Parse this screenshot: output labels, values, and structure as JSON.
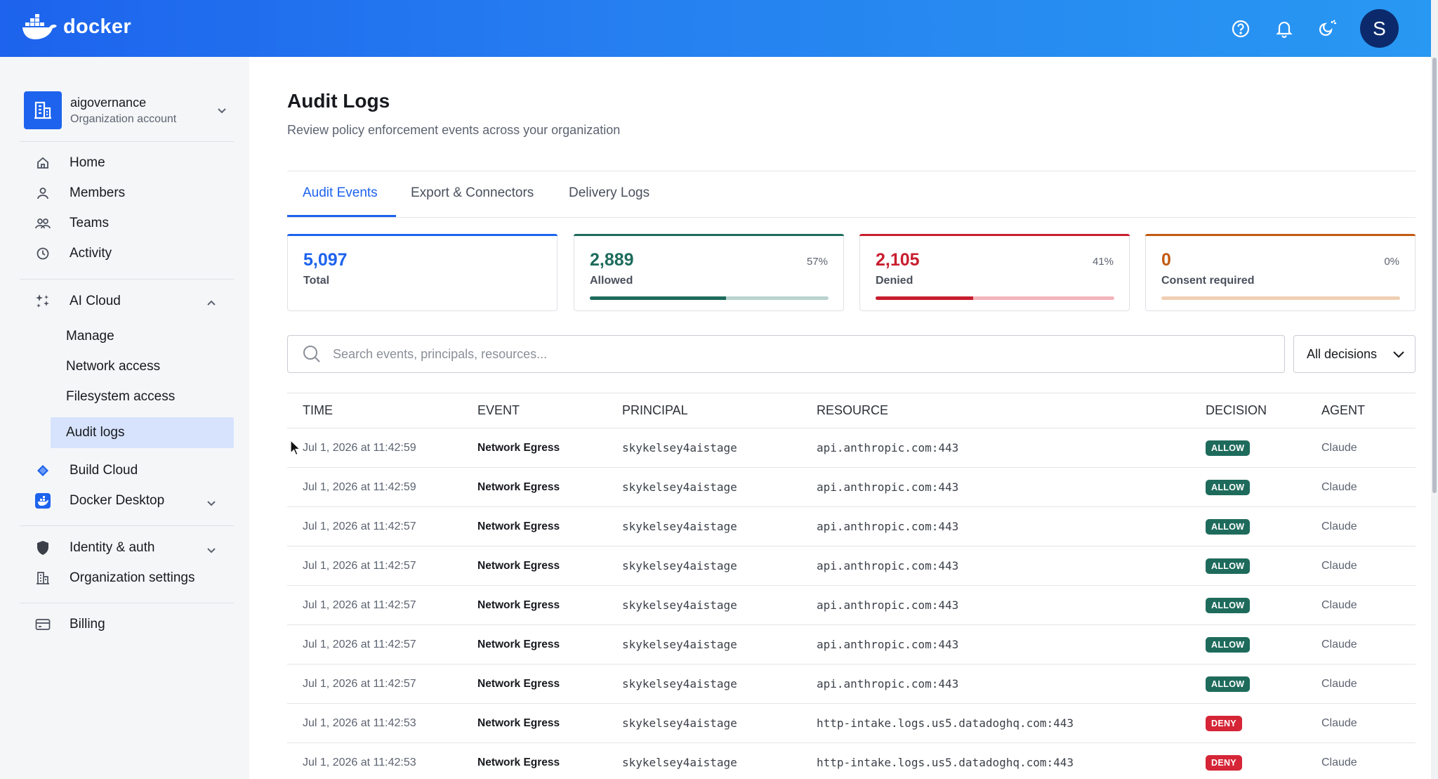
{
  "header": {
    "brand": "docker",
    "avatar_initial": "S",
    "icons": [
      "help-icon",
      "bell-icon",
      "theme-toggle-icon"
    ]
  },
  "sidebar": {
    "org_name": "aigovernance",
    "org_type": "Organization account",
    "items": [
      {
        "label": "Home",
        "icon": "home-icon"
      },
      {
        "label": "Members",
        "icon": "person-icon"
      },
      {
        "label": "Teams",
        "icon": "teams-icon"
      },
      {
        "label": "Activity",
        "icon": "clock-icon"
      }
    ],
    "ai_cloud": {
      "label": "AI Cloud",
      "children": [
        "Manage",
        "Network access",
        "Filesystem access",
        "Audit logs"
      ],
      "active": "Audit logs"
    },
    "build_cloud": "Build Cloud",
    "docker_desktop": "Docker Desktop",
    "identity": "Identity & auth",
    "org_settings": "Organization settings",
    "billing": "Billing"
  },
  "page": {
    "title": "Audit Logs",
    "subtitle": "Review policy enforcement events across your organization",
    "tabs": [
      "Audit Events",
      "Export & Connectors",
      "Delivery Logs"
    ],
    "active_tab": "Audit Events"
  },
  "stats": [
    {
      "value": "5,097",
      "label": "Total",
      "pct": "",
      "fraction": 1.0,
      "color": "#1d63ed"
    },
    {
      "value": "2,889",
      "label": "Allowed",
      "pct": "57%",
      "fraction": 0.57,
      "color": "#1e6b5c",
      "track": "#b9d3cf"
    },
    {
      "value": "2,105",
      "label": "Denied",
      "pct": "41%",
      "fraction": 0.41,
      "color": "#c81e2e",
      "track": "#f4b5bc"
    },
    {
      "value": "0",
      "label": "Consent required",
      "pct": "0%",
      "fraction": 0.0,
      "color": "#c25a10",
      "track": "#efcfb2"
    }
  ],
  "search": {
    "placeholder": "Search events, principals, resources..."
  },
  "filter": {
    "selected": "All decisions"
  },
  "table": {
    "columns": [
      "TIME",
      "EVENT",
      "PRINCIPAL",
      "RESOURCE",
      "DECISION",
      "AGENT"
    ],
    "rows": [
      [
        "Jul 1, 2026 at 11:42:59",
        "Network Egress",
        "skykelsey4aistage",
        "api.anthropic.com:443",
        "ALLOW",
        "Claude"
      ],
      [
        "Jul 1, 2026 at 11:42:59",
        "Network Egress",
        "skykelsey4aistage",
        "api.anthropic.com:443",
        "ALLOW",
        "Claude"
      ],
      [
        "Jul 1, 2026 at 11:42:57",
        "Network Egress",
        "skykelsey4aistage",
        "api.anthropic.com:443",
        "ALLOW",
        "Claude"
      ],
      [
        "Jul 1, 2026 at 11:42:57",
        "Network Egress",
        "skykelsey4aistage",
        "api.anthropic.com:443",
        "ALLOW",
        "Claude"
      ],
      [
        "Jul 1, 2026 at 11:42:57",
        "Network Egress",
        "skykelsey4aistage",
        "api.anthropic.com:443",
        "ALLOW",
        "Claude"
      ],
      [
        "Jul 1, 2026 at 11:42:57",
        "Network Egress",
        "skykelsey4aistage",
        "api.anthropic.com:443",
        "ALLOW",
        "Claude"
      ],
      [
        "Jul 1, 2026 at 11:42:57",
        "Network Egress",
        "skykelsey4aistage",
        "api.anthropic.com:443",
        "ALLOW",
        "Claude"
      ],
      [
        "Jul 1, 2026 at 11:42:53",
        "Network Egress",
        "skykelsey4aistage",
        "http-intake.logs.us5.datadoghq.com:443",
        "DENY",
        "Claude"
      ],
      [
        "Jul 1, 2026 at 11:42:53",
        "Network Egress",
        "skykelsey4aistage",
        "http-intake.logs.us5.datadoghq.com:443",
        "DENY",
        "Claude"
      ]
    ]
  }
}
